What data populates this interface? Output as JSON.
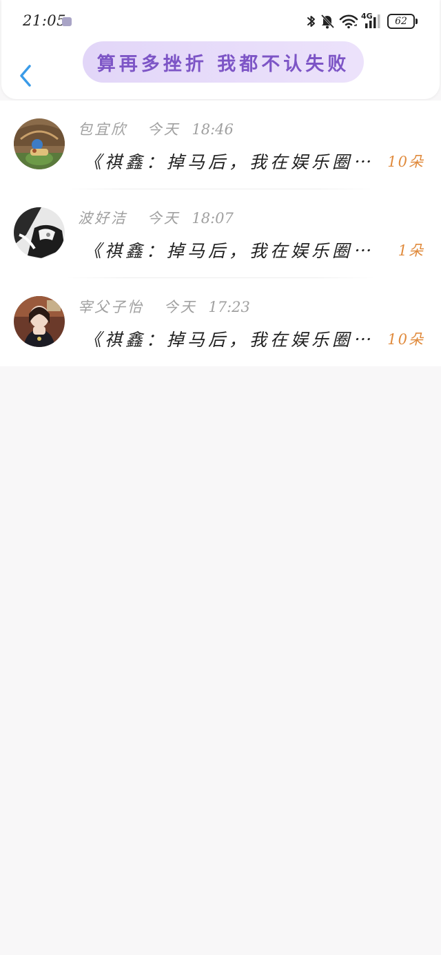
{
  "status_bar": {
    "time": "21:05",
    "network": "4G",
    "battery": "62"
  },
  "header": {
    "title": "算再多挫折 我都不认失败"
  },
  "messages": [
    {
      "name": "包宜欣",
      "day": "今天",
      "time": "18:46",
      "excerpt": "《祺鑫：掉马后，我在娱乐圈⋯",
      "count": "10朵"
    },
    {
      "name": "波好洁",
      "day": "今天",
      "time": "18:07",
      "excerpt": "《祺鑫：掉马后，我在娱乐圈⋯",
      "count": "1朵"
    },
    {
      "name": "宰父子怡",
      "day": "今天",
      "time": "17:23",
      "excerpt": "《祺鑫：掉马后，我在娱乐圈⋯",
      "count": "10朵"
    }
  ],
  "colors": {
    "accent_back": "#3a9be8",
    "title_purple": "#7d55c6",
    "count_orange": "#e08a3c"
  }
}
